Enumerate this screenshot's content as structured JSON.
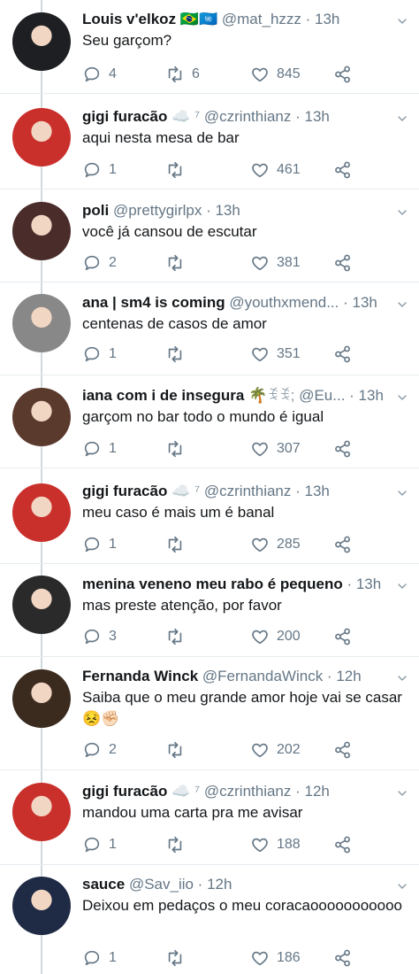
{
  "tweets": [
    {
      "name": "Louis v'elkoz",
      "badge": "🇧🇷🇺🇳",
      "handle": "@mat_hzzz",
      "time": "13h",
      "text": "Seu garçom?",
      "replies": "4",
      "retweets": "6",
      "likes": "845",
      "avatar_color": "#1d1f22"
    },
    {
      "name": "gigi furacão",
      "badge": "☁️ ⁷",
      "handle": "@czrinthianz",
      "time": "13h",
      "text": "aqui nesta mesa de bar",
      "replies": "1",
      "retweets": "",
      "likes": "461",
      "avatar_color": "#c9302c"
    },
    {
      "name": "poli",
      "badge": "",
      "handle": "@prettygirlpx",
      "time": "13h",
      "text": "você já cansou de escutar",
      "replies": "2",
      "retweets": "",
      "likes": "381",
      "avatar_color": "#4a2c2a"
    },
    {
      "name": "ana | sm4 is coming",
      "badge": "",
      "handle": "@youthxmend...",
      "time": "13h",
      "text": "centenas de casos de amor",
      "replies": "1",
      "retweets": "",
      "likes": "351",
      "avatar_color": "#888888"
    },
    {
      "name": "iana com i de insegura",
      "badge": "🌴ꉂꉂ;",
      "handle": "@Eu...",
      "time": "13h",
      "text": "garçom no bar todo o mundo é igual",
      "replies": "1",
      "retweets": "",
      "likes": "307",
      "avatar_color": "#5b3a2e"
    },
    {
      "name": "gigi furacão",
      "badge": "☁️ ⁷",
      "handle": "@czrinthianz",
      "time": "13h",
      "text": "meu caso é mais um é banal",
      "replies": "1",
      "retweets": "",
      "likes": "285",
      "avatar_color": "#c9302c"
    },
    {
      "name": "menina veneno meu rabo é pequeno",
      "badge": "",
      "handle": "",
      "time": "13h",
      "text": "mas preste atenção, por favor",
      "replies": "3",
      "retweets": "",
      "likes": "200",
      "avatar_color": "#2a2a2a"
    },
    {
      "name": "Fernanda Winck",
      "badge": "",
      "handle": "@FernandaWinck",
      "time": "12h",
      "text": "Saiba que o meu grande amor hoje vai se casar 😣✊🏻",
      "replies": "2",
      "retweets": "",
      "likes": "202",
      "avatar_color": "#3b2b1f"
    },
    {
      "name": "gigi furacão",
      "badge": "☁️ ⁷",
      "handle": "@czrinthianz",
      "time": "12h",
      "text": "mandou uma carta pra me avisar",
      "replies": "1",
      "retweets": "",
      "likes": "188",
      "avatar_color": "#c9302c"
    },
    {
      "name": "sauce",
      "badge": "",
      "handle": "@Sav_iio",
      "time": "12h",
      "text": "Deixou em pedaços o meu coracaooooooooooo",
      "replies": "1",
      "retweets": "",
      "likes": "186",
      "avatar_color": "#1f2a44"
    }
  ],
  "icons": {
    "reply": "reply-icon",
    "retweet": "retweet-icon",
    "like": "heart-icon",
    "share": "share-icon",
    "more": "chevron-down-icon"
  }
}
